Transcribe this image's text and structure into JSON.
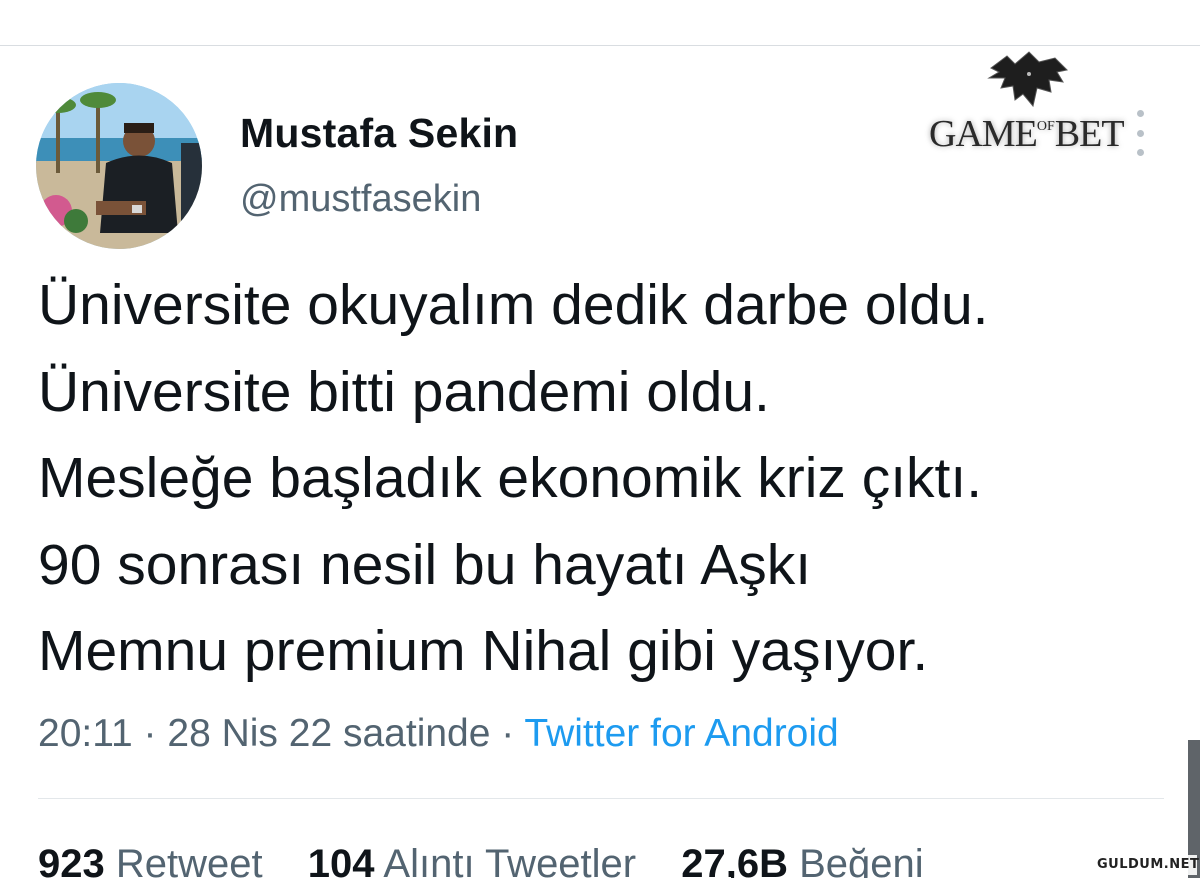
{
  "profile": {
    "display_name": "Mustafa Sekin",
    "handle": "@mustfasekin"
  },
  "logo": {
    "text_main_1": "GAME",
    "text_of": "OF",
    "text_main_2": "BET",
    "icon": "wolf-head-icon"
  },
  "tweet": {
    "lines": [
      "Üniversite okuyalım dedik darbe oldu.",
      "Üniversite bitti pandemi oldu.",
      "Mesleğe başladık ekonomik kriz çıktı.",
      "90 sonrası nesil bu hayatı Aşkı",
      "Memnu premium Nihal gibi yaşıyor."
    ]
  },
  "meta": {
    "time": "20:11",
    "separator": "·",
    "date": "28 Nis 22 saatinde",
    "source": "Twitter for Android"
  },
  "stats": [
    {
      "count": "923",
      "label": "Retweet"
    },
    {
      "count": "104",
      "label": "Alıntı Tweetler"
    },
    {
      "count": "27,6B",
      "label": "Beğeni"
    }
  ],
  "watermark": "GULDUM.NET",
  "colors": {
    "text_primary": "#0f1419",
    "text_secondary": "#536471",
    "link": "#1d9bf0",
    "divider": "#e3e7ea"
  }
}
